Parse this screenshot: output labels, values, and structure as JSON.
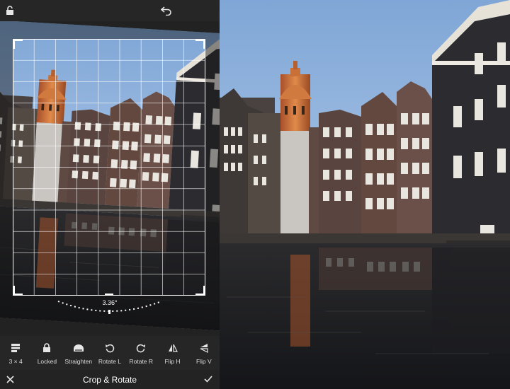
{
  "app": {
    "mode_title": "Crop & Rotate"
  },
  "topbar": {
    "left_icon": "crop-lock-icon",
    "right_icon": "undo-icon"
  },
  "crop": {
    "angle_label": "3.36°",
    "rotation_degrees": 3.36,
    "grid": "3x4 rule-of-thirds grid"
  },
  "toolbar": {
    "tools": [
      {
        "label": "3 × 4",
        "icon": "aspect-ratio-icon"
      },
      {
        "label": "Locked",
        "icon": "lock-icon"
      },
      {
        "label": "Straighten",
        "icon": "straighten-icon"
      },
      {
        "label": "Rotate L",
        "icon": "rotate-left-icon"
      },
      {
        "label": "Rotate R",
        "icon": "rotate-right-icon"
      },
      {
        "label": "Flip H",
        "icon": "flip-horizontal-icon"
      },
      {
        "label": "Flip V",
        "icon": "flip-vertical-icon"
      }
    ]
  },
  "bottombar": {
    "cancel_icon": "close-icon",
    "confirm_icon": "checkmark-icon"
  },
  "colors": {
    "panel_bg": "#2a2a2a",
    "toolbar_bg": "#262626",
    "text": "#ffffff",
    "sky": "#8fb4dd",
    "water": "#1a1c20"
  }
}
